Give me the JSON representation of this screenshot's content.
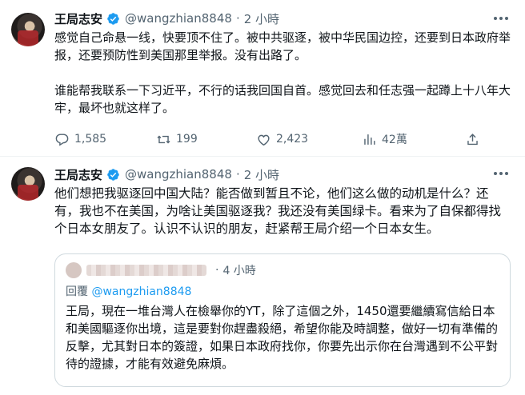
{
  "tweets": [
    {
      "author": {
        "name": "王局志安",
        "handle": "@wangzhian8848"
      },
      "dot": "·",
      "time": "2 小時",
      "paragraphs": [
        "感觉自己命悬一线，快要顶不住了。被中共驱逐，被中华民国边控，还要到日本政府举报，还要预防性到美国那里举报。没有出路了。",
        "谁能帮我联系一下习近平，不行的话我回国自首。感觉回去和任志强一起蹲上十八年大牢，最坏也就这样了。"
      ],
      "stats": {
        "replies": "1,585",
        "retweets": "199",
        "likes": "2,423",
        "views": "42萬"
      }
    },
    {
      "author": {
        "name": "王局志安",
        "handle": "@wangzhian8848"
      },
      "dot": "·",
      "time": "2 小時",
      "paragraphs": [
        "他们想把我驱逐回中国大陆？能否做到暂且不论，他们这么做的动机是什么？还有，我也不在美国，为啥让美国驱逐我？我还没有美国绿卡。看来为了自保都得找个日本女朋友了。认识不认识的朋友，赶紧帮王局介绍一个日本女生。"
      ],
      "quote": {
        "dot": "·",
        "time": "4 小時",
        "reply_prefix": "回覆 ",
        "reply_mention": "@wangzhian8848",
        "text": "王局，現在一堆台灣人在檢舉你的YT，除了這個之外，1450還要繼續寫信給日本和美國驅逐你出境，這是要對你趕盡殺絕，希望你能及時調整，做好一切有準備的反擊，尤其對日本的簽證，如果日本政府找你，你要先出示你在台灣遇到不公平對待的證據，才能有效避免麻煩。"
      }
    }
  ],
  "icons": {
    "verified": "verified-badge-icon",
    "more": "more-options-icon",
    "reply": "reply-icon",
    "retweet": "retweet-icon",
    "like": "like-icon",
    "views": "views-icon",
    "share": "share-icon"
  },
  "colors": {
    "verified": "#1d9bf0",
    "muted": "#536471",
    "text": "#0f1419",
    "border": "#cfd9de"
  }
}
